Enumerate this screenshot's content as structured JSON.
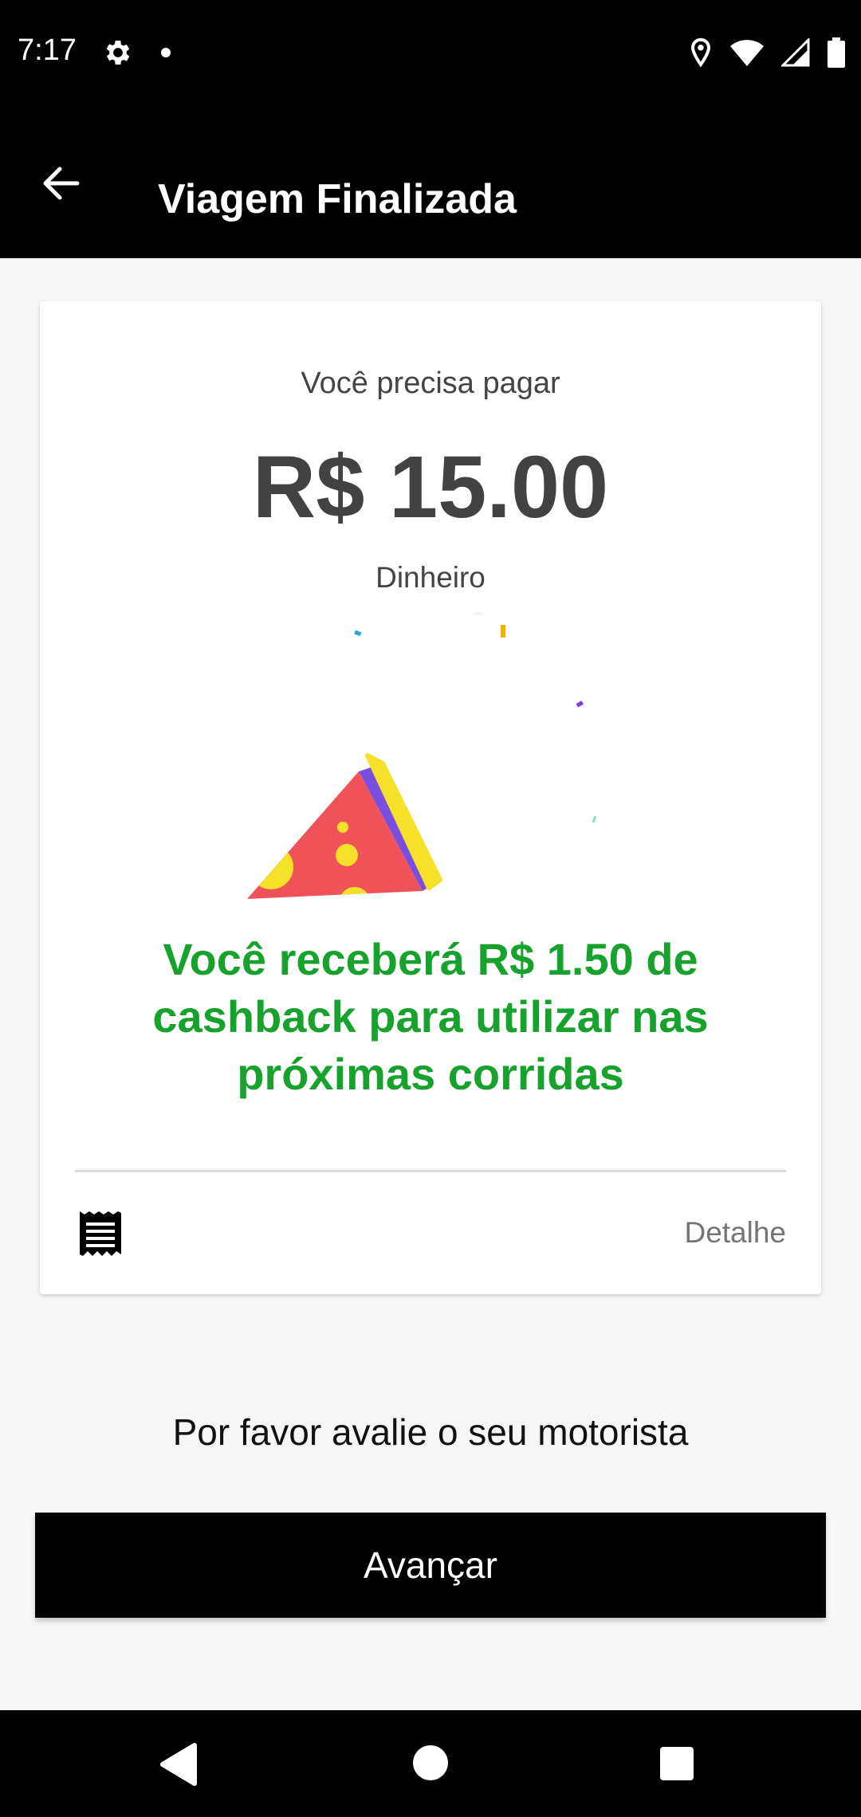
{
  "status_bar": {
    "time": "7:17",
    "icons": [
      "gear-icon",
      "notification-dot-icon",
      "location-icon",
      "wifi-icon",
      "signal-icon",
      "battery-icon"
    ]
  },
  "app_bar": {
    "back_icon": "arrow-left-icon",
    "title": "Viagem Finalizada"
  },
  "payment_card": {
    "label": "Você precisa pagar",
    "amount": "R$ 15.00",
    "method": "Dinheiro",
    "illustration_icon": "party-popper-icon",
    "cashback_message": "Você receberá R$ 1.50 de cashback para utilizar nas próximas corridas",
    "receipt_icon": "receipt-icon",
    "detail_label": "Detalhe"
  },
  "rating_prompt": "Por favor avalie o seu motorista",
  "primary_button": {
    "label": "Avançar"
  },
  "nav_bar": {
    "icons": [
      "nav-back-icon",
      "nav-home-icon",
      "nav-recents-icon"
    ]
  },
  "colors": {
    "accent_green": "#16a22c",
    "bar_black": "#000000",
    "party_red": "#f0525a",
    "party_yellow": "#f5e02a",
    "party_purple": "#7a4fe0"
  }
}
